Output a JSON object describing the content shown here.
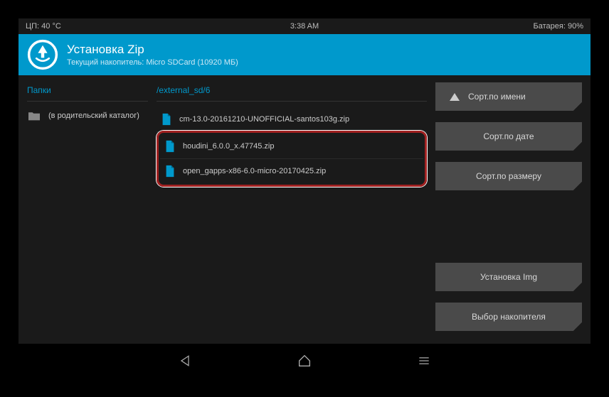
{
  "status": {
    "cpu": "ЦП: 40 °C",
    "time": "3:38 AM",
    "battery": "Батарея: 90%"
  },
  "header": {
    "title": "Установка Zip",
    "subtitle": "Текущий накопитель: Micro SDCard (10920 МБ)"
  },
  "folders": {
    "label": "Папки",
    "parent": "(в родительский каталог)"
  },
  "path": "/external_sd/6",
  "files": [
    {
      "name": "cm-13.0-20161210-UNOFFICIAL-santos103g.zip"
    },
    {
      "name": "houdini_6.0.0_x.47745.zip"
    },
    {
      "name": "open_gapps-x86-6.0-micro-20170425.zip"
    }
  ],
  "buttons": {
    "sort_name": "Сорт.по имени",
    "sort_date": "Сорт.по дате",
    "sort_size": "Сорт.по размеру",
    "install_img": "Установка Img",
    "select_storage": "Выбор накопителя"
  }
}
